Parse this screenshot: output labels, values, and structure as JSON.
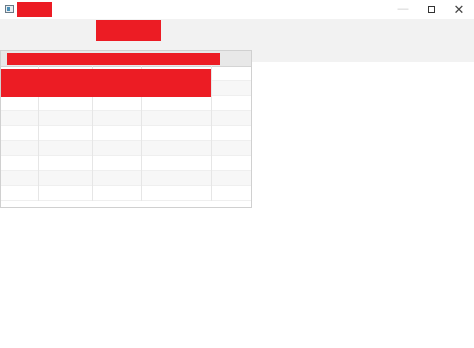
{
  "window": {
    "title": "",
    "controls": {
      "minimize": "—",
      "maximize": "",
      "close": "✕"
    }
  },
  "toolbar": {
    "block_label": ""
  },
  "table": {
    "header_label": "",
    "columns": [
      "",
      "",
      "",
      "",
      ""
    ],
    "rows": [
      [
        "",
        "",
        "",
        "",
        ""
      ],
      [
        "",
        "",
        "",
        "",
        ""
      ],
      [
        "",
        "",
        "",
        "",
        ""
      ],
      [
        "",
        "",
        "",
        "",
        ""
      ],
      [
        "",
        "",
        "",
        "",
        ""
      ],
      [
        "",
        "",
        "",
        "",
        ""
      ],
      [
        "",
        "",
        "",
        "",
        ""
      ],
      [
        "",
        "",
        "",
        "",
        ""
      ],
      [
        "",
        "",
        "",
        "",
        ""
      ]
    ]
  },
  "colors": {
    "redaction": "#ec1c24",
    "toolbar_bg": "#f2f2f2",
    "header_bg": "#e8e8e8",
    "alt_row_bg": "#f7f7f7"
  },
  "icons": {
    "app": "app-icon",
    "minimize": "minimize-icon",
    "maximize": "maximize-icon",
    "close": "close-icon"
  }
}
